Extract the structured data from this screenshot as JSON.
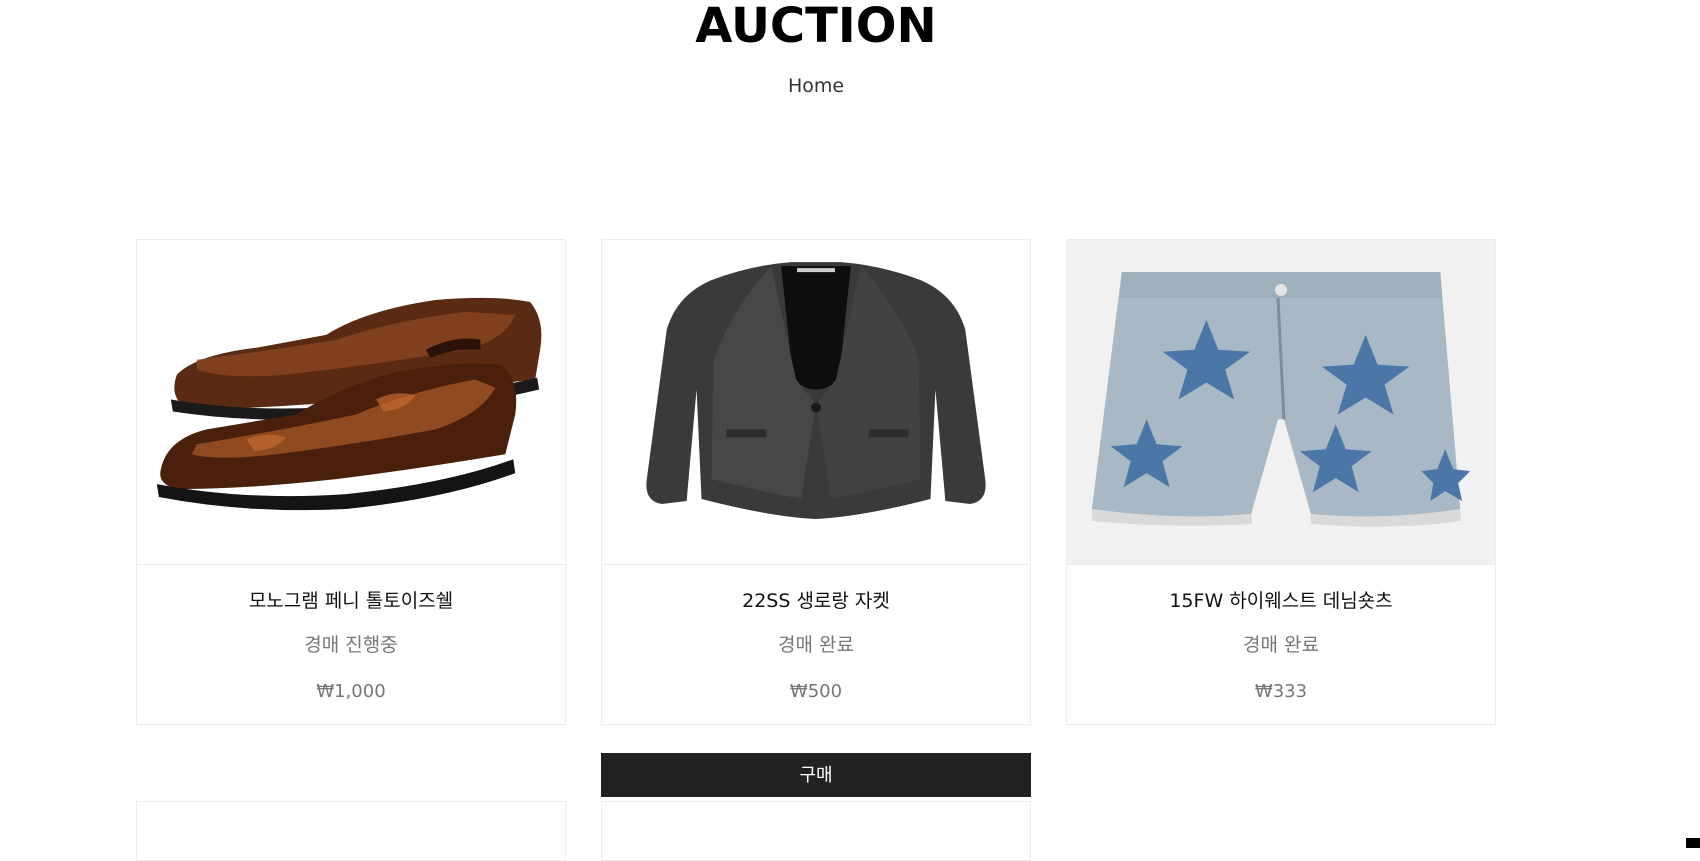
{
  "header": {
    "title": "AUCTION",
    "breadcrumb": "Home"
  },
  "products": [
    {
      "name": "모노그램 페니 톨토이즈쉘",
      "status": "경매 진행중",
      "price": "₩1,000",
      "image_icon": "loafer-shoes-image"
    },
    {
      "name": "22SS 생로랑 자켓",
      "status": "경매 완료",
      "price": "₩500",
      "image_icon": "jacket-image"
    },
    {
      "name": "15FW 하이웨스트 데님숏츠",
      "status": "경매 완료",
      "price": "₩333",
      "image_icon": "denim-shorts-image"
    }
  ],
  "actions": {
    "buy_label": "구매"
  },
  "colors": {
    "button_bg": "#222222",
    "border": "#ececec",
    "muted_text": "#777777"
  }
}
